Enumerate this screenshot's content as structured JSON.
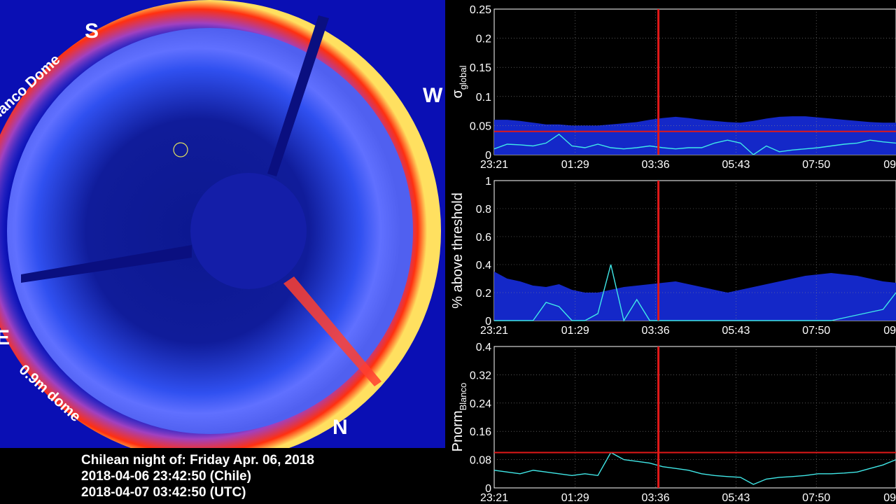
{
  "sky_image": {
    "directions": {
      "south": "S",
      "west": "W",
      "east": "E",
      "north": "N"
    },
    "dome_labels": {
      "blanco": "lanco Dome",
      "small": "0.9m dome"
    },
    "colors": {
      "background": "#0a0fb4",
      "edge_hot": "#ff3010",
      "edge_warm": "#ffe060"
    }
  },
  "caption": {
    "line1": "Chilean night of: Friday Apr. 06, 2018",
    "line2": "2018-04-06 23:42:50 (Chile)",
    "line3": "2018-04-07 03:42:50 (UTC)"
  },
  "chart_data": [
    {
      "type": "area",
      "ylabel_main": "σ",
      "ylabel_sub": "global",
      "ylim": [
        0,
        0.25
      ],
      "yticks": [
        "0",
        "0.05",
        "0.1",
        "0.15",
        "0.2",
        "0.25"
      ],
      "xtick_labels": [
        "23:21",
        "01:29",
        "03:36",
        "05:43",
        "07:50",
        "09"
      ],
      "threshold": 0.04,
      "current_time_index": 2,
      "grid": true,
      "series": [
        {
          "color": "#1428c8",
          "values": [
            0.06,
            0.06,
            0.058,
            0.055,
            0.052,
            0.052,
            0.05,
            0.05,
            0.05,
            0.052,
            0.054,
            0.056,
            0.06,
            0.063,
            0.065,
            0.063,
            0.06,
            0.058,
            0.056,
            0.055,
            0.058,
            0.062,
            0.065,
            0.066,
            0.066,
            0.064,
            0.062,
            0.06,
            0.058,
            0.056,
            0.055,
            0.055
          ]
        },
        {
          "color": "#40e8e8",
          "values": [
            0.01,
            0.018,
            0.017,
            0.015,
            0.02,
            0.035,
            0.015,
            0.012,
            0.018,
            0.012,
            0.01,
            0.012,
            0.015,
            0.012,
            0.01,
            0.012,
            0.012,
            0.02,
            0.025,
            0.02,
            0.0,
            0.015,
            0.005,
            0.008,
            0.01,
            0.012,
            0.015,
            0.018,
            0.02,
            0.025,
            0.022,
            0.02
          ]
        }
      ]
    },
    {
      "type": "area",
      "ylabel_main": "% above threshold",
      "ylim": [
        0,
        1
      ],
      "yticks": [
        "0",
        "0.2",
        "0.4",
        "0.6",
        "0.8",
        "1"
      ],
      "xtick_labels": [
        "23:21",
        "01:29",
        "03:36",
        "05:43",
        "07:50",
        "09"
      ],
      "current_time_index": 2,
      "grid": true,
      "series": [
        {
          "color": "#1428c8",
          "values": [
            0.35,
            0.3,
            0.28,
            0.25,
            0.24,
            0.26,
            0.22,
            0.2,
            0.2,
            0.22,
            0.24,
            0.25,
            0.26,
            0.27,
            0.28,
            0.26,
            0.24,
            0.22,
            0.2,
            0.22,
            0.24,
            0.26,
            0.28,
            0.3,
            0.32,
            0.33,
            0.34,
            0.33,
            0.32,
            0.3,
            0.28,
            0.27
          ]
        },
        {
          "color": "#40e8e8",
          "values": [
            0.0,
            0.0,
            0.0,
            0.0,
            0.13,
            0.1,
            0.0,
            0.0,
            0.05,
            0.4,
            0.0,
            0.15,
            0.0,
            0.0,
            0.0,
            0.0,
            0.0,
            0.0,
            0.0,
            0.0,
            0.0,
            0.0,
            0.0,
            0.0,
            0.0,
            0.0,
            0.0,
            0.02,
            0.04,
            0.06,
            0.08,
            0.2
          ]
        }
      ]
    },
    {
      "type": "line",
      "ylabel_main": "Pnorm",
      "ylabel_sub": "Blanco",
      "ylim": [
        0,
        0.4
      ],
      "yticks": [
        "0",
        "0.08",
        "0.16",
        "0.24",
        "0.32",
        "0.4"
      ],
      "xtick_labels": [
        "23:21",
        "01:29",
        "03:36",
        "05:43",
        "07:50",
        "09"
      ],
      "threshold": 0.1,
      "current_time_index": 2,
      "grid": true,
      "series": [
        {
          "color": "#40e8e8",
          "values": [
            0.05,
            0.045,
            0.04,
            0.05,
            0.045,
            0.04,
            0.035,
            0.04,
            0.035,
            0.1,
            0.08,
            0.075,
            0.07,
            0.06,
            0.055,
            0.05,
            0.04,
            0.035,
            0.032,
            0.03,
            0.01,
            0.025,
            0.03,
            0.032,
            0.035,
            0.04,
            0.04,
            0.042,
            0.045,
            0.055,
            0.065,
            0.08
          ]
        }
      ]
    }
  ]
}
